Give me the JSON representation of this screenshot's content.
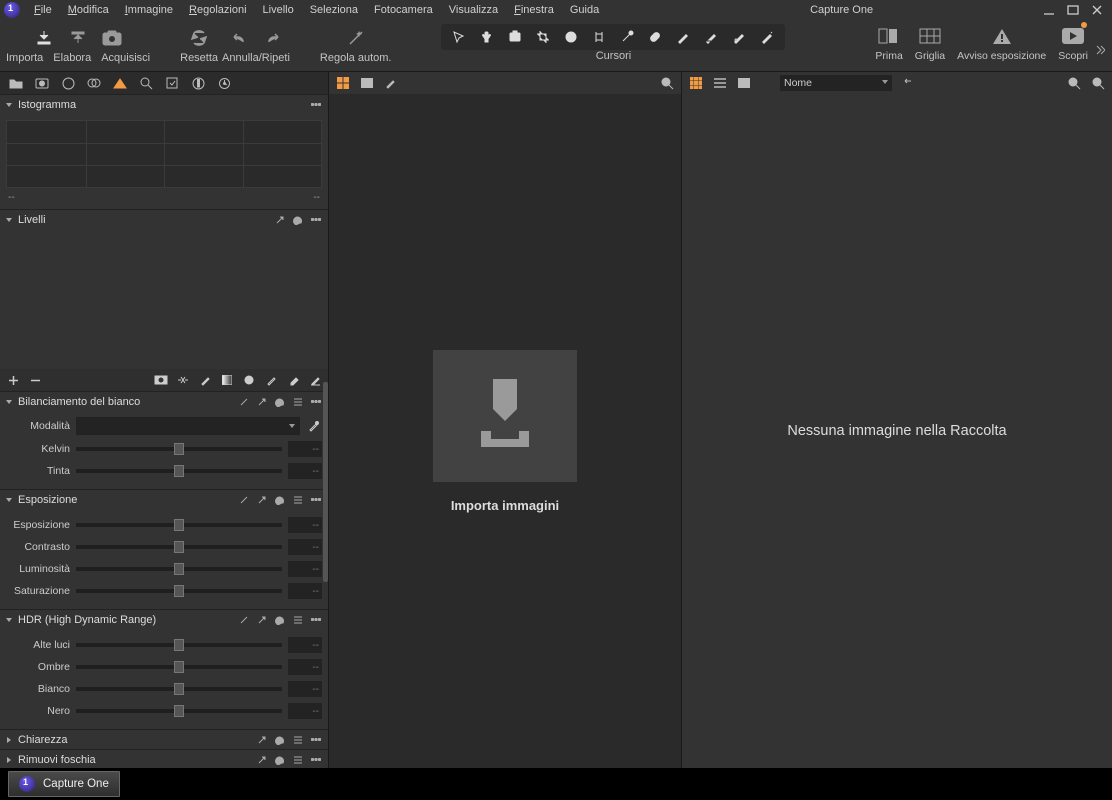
{
  "app_title": "Capture One",
  "menubar": {
    "items": [
      {
        "label": "File",
        "underline": "F"
      },
      {
        "label": "Modifica",
        "underline": "M"
      },
      {
        "label": "Immagine",
        "underline": "I"
      },
      {
        "label": "Regolazioni",
        "underline": "R"
      },
      {
        "label": "Livello"
      },
      {
        "label": "Seleziona"
      },
      {
        "label": "Fotocamera"
      },
      {
        "label": "Visualizza"
      },
      {
        "label": "Finestra",
        "underline": "F"
      },
      {
        "label": "Guida"
      }
    ]
  },
  "toolbar": {
    "left": [
      {
        "name": "importa",
        "label": "Importa"
      },
      {
        "name": "elabora",
        "label": "Elabora"
      },
      {
        "name": "acquisisci",
        "label": "Acquisisci"
      }
    ],
    "reset": {
      "label": "Resetta"
    },
    "undo": {
      "label": "Annulla/Ripeti"
    },
    "autoadjust": {
      "label": "Regola autom."
    },
    "cursors_label": "Cursori",
    "right": [
      {
        "name": "prima",
        "label": "Prima"
      },
      {
        "name": "griglia",
        "label": "Griglia"
      },
      {
        "name": "avviso",
        "label": "Avviso esposizione"
      },
      {
        "name": "scopri",
        "label": "Scopri"
      }
    ]
  },
  "tool_tabs": [
    "library",
    "capture",
    "lens",
    "crop",
    "color",
    "exposure",
    "details",
    "settings",
    "output",
    "annotations"
  ],
  "active_tool_tab": 4,
  "panels": {
    "histogram": {
      "title": "Istogramma",
      "values_left": "--",
      "values_right": "--"
    },
    "levels": {
      "title": "Livelli"
    },
    "white_balance": {
      "title": "Bilanciamento del bianco",
      "mode_label": "Modalità",
      "mode_value": "",
      "rows": [
        {
          "label": "Kelvin",
          "value": "--",
          "pos": 50
        },
        {
          "label": "Tinta",
          "value": "--",
          "pos": 50
        }
      ]
    },
    "exposure": {
      "title": "Esposizione",
      "rows": [
        {
          "label": "Esposizione",
          "value": "--",
          "pos": 50
        },
        {
          "label": "Contrasto",
          "value": "--",
          "pos": 50
        },
        {
          "label": "Luminosità",
          "value": "--",
          "pos": 50
        },
        {
          "label": "Saturazione",
          "value": "--",
          "pos": 50
        }
      ]
    },
    "hdr": {
      "title": "HDR (High Dynamic Range)",
      "rows": [
        {
          "label": "Alte luci",
          "value": "--",
          "pos": 50
        },
        {
          "label": "Ombre",
          "value": "--",
          "pos": 50
        },
        {
          "label": "Bianco",
          "value": "--",
          "pos": 50
        },
        {
          "label": "Nero",
          "value": "--",
          "pos": 50
        }
      ]
    },
    "clarity": {
      "title": "Chiarezza"
    },
    "dehaze": {
      "title": "Rimuovi foschia"
    }
  },
  "viewer": {
    "import_caption": "Importa immagini"
  },
  "browser": {
    "sort_label": "Nome",
    "empty_message": "Nessuna immagine nella Raccolta"
  },
  "taskbar": {
    "app": "Capture One"
  }
}
